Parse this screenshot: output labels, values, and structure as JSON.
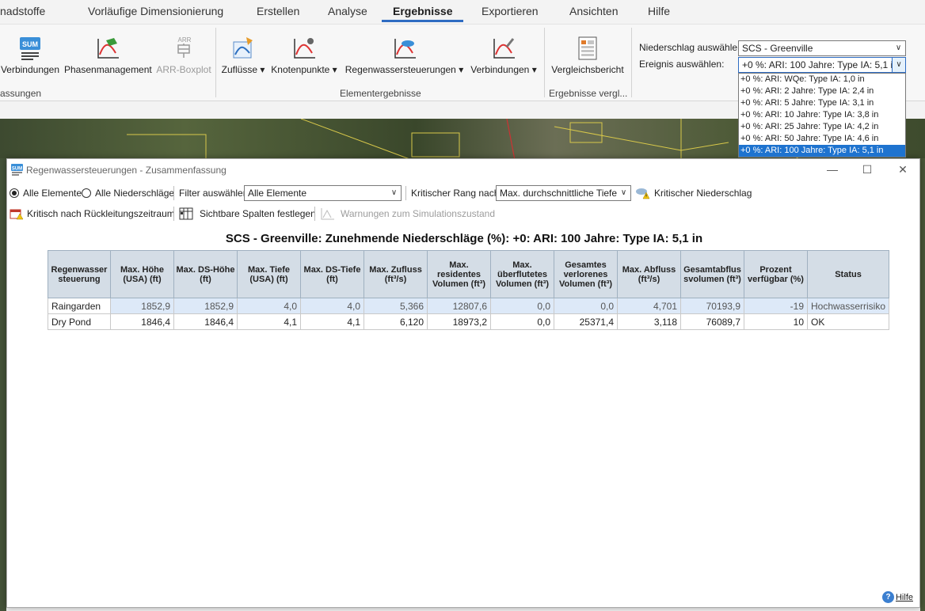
{
  "menu": {
    "tabs": [
      "nadstoffe",
      "Vorläufige Dimensionierung",
      "Erstellen",
      "Analyse",
      "Ergebnisse",
      "Exportieren",
      "Ansichten",
      "Hilfe"
    ],
    "active_tab": "Ergebnisse"
  },
  "ribbon": {
    "summary_group": {
      "buttons": [
        "Verbindungen",
        "Phasenmanagement",
        "ARR-Boxplot"
      ],
      "label": "assungen",
      "sum_icon_text": "SUM",
      "arr_icon_text": "ARR"
    },
    "element_group": {
      "buttons": [
        "Zuflüsse",
        "Knotenpunkte",
        "Regenwassersteuerungen",
        "Verbindungen"
      ],
      "label": "Elementergebnisse"
    },
    "compare_group": {
      "buttons": [
        "Vergleichsbericht"
      ],
      "label": "Ergebnisse vergl..."
    },
    "precip": {
      "label": "Niederschlag auswählen:",
      "value": "SCS - Greenville"
    },
    "event": {
      "label": "Ereignis auswählen:",
      "value": "+0 %: ARI: 100 Jahre: Type IA: 5,1 in",
      "options": [
        "+0 %: ARI: WQe: Type IA: 1,0 in",
        "+0 %: ARI: 2 Jahre: Type IA: 2,4 in",
        "+0 %: ARI: 5 Jahre: Type IA: 3,1 in",
        "+0 %: ARI: 10 Jahre: Type IA: 3,8 in",
        "+0 %: ARI: 25 Jahre: Type IA: 4,2 in",
        "+0 %: ARI: 50 Jahre: Type IA: 4,6 in",
        "+0 %: ARI: 100 Jahre: Type IA: 5,1 in"
      ],
      "selected_index": 6
    }
  },
  "dialog": {
    "title": "Regenwassersteuerungen - Zusammenfassung",
    "icon_text": "SUM",
    "toolbar": {
      "all_elements": "Alle Elemente",
      "all_precip": "Alle Niederschläge",
      "filter_label": "Filter auswählen",
      "filter_value": "Alle Elemente",
      "rank_label": "Kritischer Rang nach:",
      "rank_value": "Max. durchschnittliche Tiefe",
      "critical_precip": "Kritischer Niederschlag",
      "critical_return": "Kritisch nach Rückleitungszeitraum",
      "visible_columns": "Sichtbare Spalten festlegen",
      "warnings": "Warnungen zum Simulationszustand"
    },
    "heading": "SCS - Greenville: Zunehmende Niederschläge (%): +0: ARI: 100 Jahre: Type IA: 5,1 in",
    "table": {
      "columns": [
        "Regenwasser steuerung",
        "Max. Höhe (USA) (ft)",
        "Max. DS-Höhe (ft)",
        "Max. Tiefe (USA) (ft)",
        "Max. DS-Tiefe (ft)",
        "Max. Zufluss (ft³/s)",
        "Max. residentes Volumen (ft³)",
        "Max. überflutetes Volumen (ft³)",
        "Gesamtes verlorenes Volumen (ft³)",
        "Max. Abfluss (ft³/s)",
        "Gesamtabflus svolumen (ft³)",
        "Prozent verfügbar (%)",
        "Status"
      ],
      "rows": [
        [
          "Raingarden",
          "1852,9",
          "1852,9",
          "4,0",
          "4,0",
          "5,366",
          "12807,6",
          "0,0",
          "0,0",
          "4,701",
          "70193,9",
          "-19",
          "Hochwasserrisiko"
        ],
        [
          "Dry Pond",
          "1846,4",
          "1846,4",
          "4,1",
          "4,1",
          "6,120",
          "18973,2",
          "0,0",
          "25371,4",
          "3,118",
          "76089,7",
          "10",
          "OK"
        ]
      ]
    },
    "help_label": "Hilfe"
  }
}
